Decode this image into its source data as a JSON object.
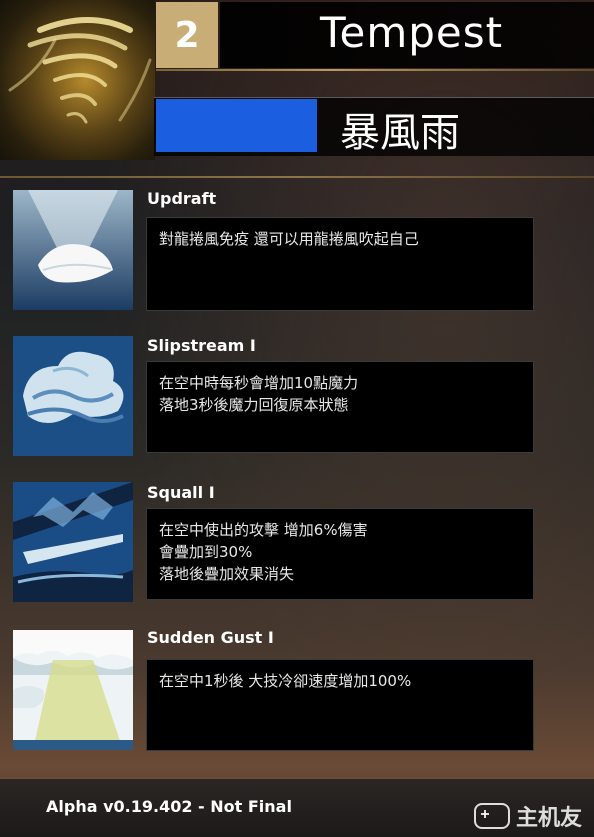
{
  "header": {
    "rank": "2",
    "title": "Tempest",
    "subtitle": "暴風雨",
    "bar_fill_fraction": 0.37,
    "icon": "tornado-icon"
  },
  "skills": [
    {
      "name": "Updraft",
      "icon": "feather-icon",
      "lines": [
        "對龍捲風免疫 還可以用龍捲風吹起自己"
      ]
    },
    {
      "name": "Slipstream  I",
      "icon": "cloud-wind-icon",
      "lines": [
        "在空中時每秒會增加10點魔力",
        "落地3秒後魔力回復原本狀態"
      ]
    },
    {
      "name": "Squall I",
      "icon": "wind-slash-icon",
      "lines": [
        "在空中使出的攻擊 增加6%傷害",
        "會疊加到30%",
        "落地後疊加效果消失"
      ]
    },
    {
      "name": "Sudden Gust I",
      "icon": "sunbeam-cloud-icon",
      "lines": [
        "在空中1秒後 大技冷卻速度增加100%"
      ]
    }
  ],
  "footer": {
    "version": "Alpha v0.19.402 - Not Final",
    "watermark": "主机友"
  },
  "colors": {
    "rank_bg": "#c9ad76",
    "bar": "#1c5ee0",
    "gold": "#b49a63"
  }
}
